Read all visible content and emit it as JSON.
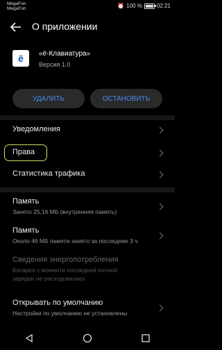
{
  "status": {
    "carrier1": "MegaFon",
    "carrier2": "MegaFon",
    "battery": "100 %",
    "time": "02:21",
    "battery_level": 1.0
  },
  "header": {
    "title": "О приложении"
  },
  "app": {
    "icon_text": "ё",
    "name": "«ё-Клавиатура»",
    "version": "Версия 1.0"
  },
  "actions": {
    "uninstall": "УДАЛИТЬ",
    "stop": "ОСТАНОВИТЬ"
  },
  "menu": {
    "notifications": "Уведомления",
    "permissions": "Права",
    "traffic": "Статистика трафика",
    "storage": {
      "label": "Память",
      "sub": "Занято 25,16 МБ (внутренняя память)"
    },
    "memory": {
      "label": "Память",
      "sub": "Около 46 МБ памяти занято за последние 3 ч"
    },
    "energy": {
      "label": "Сведения энергопотребления",
      "sub1": "Батарея с момента последней полной",
      "sub2": "зарядки не расходовалась"
    },
    "default": {
      "label": "Открывать по умолчанию",
      "sub": "Настройки по умолчанию не установлены"
    }
  }
}
